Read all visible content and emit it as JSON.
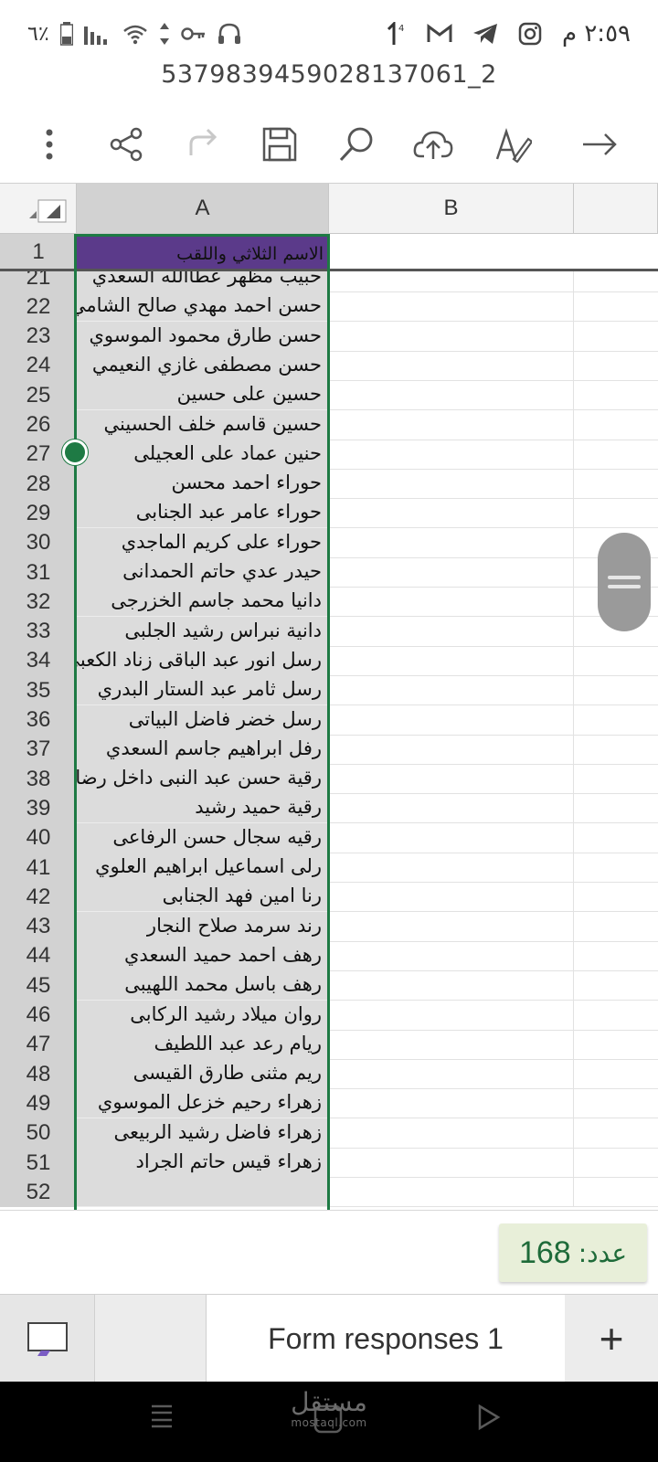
{
  "status_bar": {
    "time": "٢:٥٩ م",
    "battery": "٦٪"
  },
  "file": {
    "title": "5379839459028137061_2"
  },
  "toolbar": {
    "icons": [
      "more-vertical-icon",
      "share-icon",
      "redo-icon",
      "save-icon",
      "search-icon",
      "cloud-upload-icon",
      "draw-icon",
      "forward-arrow-icon"
    ]
  },
  "grid": {
    "columns": [
      "A",
      "B"
    ],
    "header_row": {
      "number": "1",
      "value": "الاسم الثلاثي واللقب"
    },
    "rows": [
      {
        "num": "21",
        "a": "حبيب مظهر عطاالله السعدي"
      },
      {
        "num": "22",
        "a": "حسن احمد مهدي صالح الشامي"
      },
      {
        "num": "23",
        "a": "حسن طارق محمود الموسوي"
      },
      {
        "num": "24",
        "a": "حسن مصطفى غازي النعيمي"
      },
      {
        "num": "25",
        "a": "حسين على حسين"
      },
      {
        "num": "26",
        "a": "حسين قاسم خلف الحسيني"
      },
      {
        "num": "27",
        "a": "حنين عماد على العجيلى"
      },
      {
        "num": "28",
        "a": "حوراء احمد محسن"
      },
      {
        "num": "29",
        "a": "حوراء عامر عبد الجنابى"
      },
      {
        "num": "30",
        "a": "حوراء على كريم الماجدي"
      },
      {
        "num": "31",
        "a": "حيدر عدي حاتم الحمدانى"
      },
      {
        "num": "32",
        "a": "دانيا محمد جاسم الخزرجى"
      },
      {
        "num": "33",
        "a": "دانية نبراس رشيد الجلبى"
      },
      {
        "num": "34",
        "a": "رسل انور عبد الباقى زناد الكعبى"
      },
      {
        "num": "35",
        "a": "رسل ثامر عبد الستار البدري"
      },
      {
        "num": "36",
        "a": "رسل خضر فاضل البياتى"
      },
      {
        "num": "37",
        "a": "رفل ابراهيم جاسم السعدي"
      },
      {
        "num": "38",
        "a": "رقية حسن عبد النبى داخل رضا"
      },
      {
        "num": "39",
        "a": "رقية حميد رشيد"
      },
      {
        "num": "40",
        "a": "رقيه سجال حسن الرفاعى"
      },
      {
        "num": "41",
        "a": "رلى اسماعيل ابراهيم العلوي"
      },
      {
        "num": "42",
        "a": "رنا امين فهد الجنابى"
      },
      {
        "num": "43",
        "a": "رند سرمد صلاح النجار"
      },
      {
        "num": "44",
        "a": "رهف احمد حميد السعدي"
      },
      {
        "num": "45",
        "a": "رهف باسل محمد اللهيبى"
      },
      {
        "num": "46",
        "a": "روان ميلاد رشيد الركابى"
      },
      {
        "num": "47",
        "a": "ريام رعد عبد اللطيف"
      },
      {
        "num": "48",
        "a": "ريم مثنى طارق القيسى"
      },
      {
        "num": "49",
        "a": "زهراء رحيم خزعل الموسوي"
      },
      {
        "num": "50",
        "a": "زهراء فاضل رشيد الربيعى"
      },
      {
        "num": "51",
        "a": "زهراء قيس حاتم الجراد"
      },
      {
        "num": "52",
        "a": ""
      }
    ]
  },
  "status": {
    "count_label": "عدد:",
    "count_value": "168"
  },
  "tabs": {
    "active_label": "Form responses 1",
    "add_label": "+"
  },
  "watermark": {
    "arabic": "مستقل",
    "latin": "mostaql.com"
  },
  "colors": {
    "accent": "#1e7a44",
    "header_fill": "#5b3a8a"
  }
}
